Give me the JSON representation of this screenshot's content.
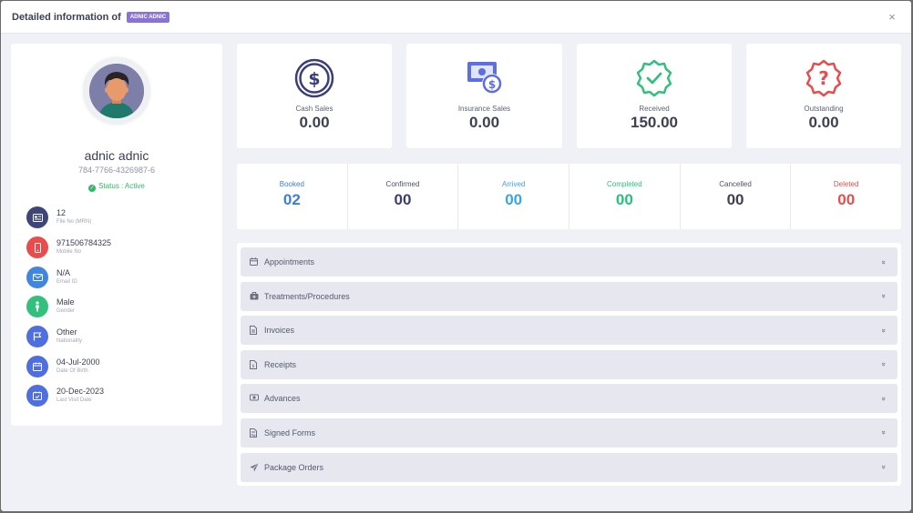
{
  "modal": {
    "title": "Detailed information of",
    "badge": "ADNIC ADNIC",
    "close": "×"
  },
  "profile": {
    "name": "adnic adnic",
    "id_number": "784-7766-4326987-6",
    "status": "Status : Active",
    "info": [
      {
        "value": "12",
        "label": "File No (MRN)",
        "icon": "id-card-icon",
        "color": "#3e4579"
      },
      {
        "value": "971506784325",
        "label": "Mobile No",
        "icon": "mobile-icon",
        "color": "#e84c4c"
      },
      {
        "value": "N/A",
        "label": "Email ID",
        "icon": "envelope-icon",
        "color": "#3f86e0"
      },
      {
        "value": "Male",
        "label": "Gender",
        "icon": "gender-icon",
        "color": "#33c07c"
      },
      {
        "value": "Other",
        "label": "Nationality",
        "icon": "flag-icon",
        "color": "#4f6fe0"
      },
      {
        "value": "04-Jul-2000",
        "label": "Date Of Birth",
        "icon": "calendar-icon",
        "color": "#4f6fe0"
      },
      {
        "value": "20-Dec-2023",
        "label": "Last Visit Date",
        "icon": "calendar-check-icon",
        "color": "#4f6fe0"
      }
    ]
  },
  "stats": [
    {
      "label": "Cash Sales",
      "value": "0.00",
      "icon": "dollar-coin-icon",
      "color": "#3a3f7a"
    },
    {
      "label": "Insurance Sales",
      "value": "0.00",
      "icon": "money-bill-icon",
      "color": "#5c6ee0"
    },
    {
      "label": "Received",
      "value": "150.00",
      "icon": "check-badge-icon",
      "color": "#33c07c"
    },
    {
      "label": "Outstanding",
      "value": "0.00",
      "icon": "question-badge-icon",
      "color": "#e84c4c"
    }
  ],
  "statuses": [
    {
      "label": "Booked",
      "value": "02",
      "color": "#3b7ddd"
    },
    {
      "label": "Confirmed",
      "value": "00",
      "color": "#3a3f6a"
    },
    {
      "label": "Arrived",
      "value": "00",
      "color": "#3aa5e0"
    },
    {
      "label": "Completed",
      "value": "00",
      "color": "#29c07a"
    },
    {
      "label": "Cancelled",
      "value": "00",
      "color": "#3e4250"
    },
    {
      "label": "Deleted",
      "value": "00",
      "color": "#e84c4c"
    }
  ],
  "sections": [
    {
      "label": "Appointments",
      "icon": "calendar-icon"
    },
    {
      "label": "Treatments/Procedures",
      "icon": "briefcase-medical-icon"
    },
    {
      "label": "Invoices",
      "icon": "file-invoice-icon"
    },
    {
      "label": "Receipts",
      "icon": "receipt-icon"
    },
    {
      "label": "Advances",
      "icon": "money-icon"
    },
    {
      "label": "Signed Forms",
      "icon": "signed-form-icon"
    },
    {
      "label": "Package Orders",
      "icon": "paper-plane-icon"
    }
  ]
}
